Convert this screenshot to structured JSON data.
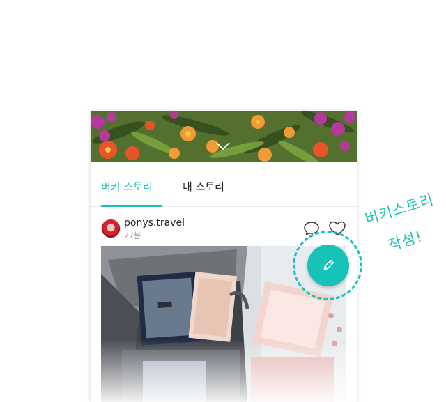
{
  "tabs": [
    {
      "label": "버키 스토리",
      "active": true
    },
    {
      "label": "내 스토리",
      "active": false
    }
  ],
  "post": {
    "username": "ponys.travel",
    "time": "27분"
  },
  "annotation": {
    "line1": "버키스토리",
    "line2": "작성!"
  },
  "icons": {
    "banner_toggle": "chevron-down-icon",
    "comment": "comment-icon",
    "like": "heart-icon",
    "write": "pencil-icon"
  },
  "colors": {
    "accent": "#1fbfb7",
    "fab": "#19c2b9"
  }
}
